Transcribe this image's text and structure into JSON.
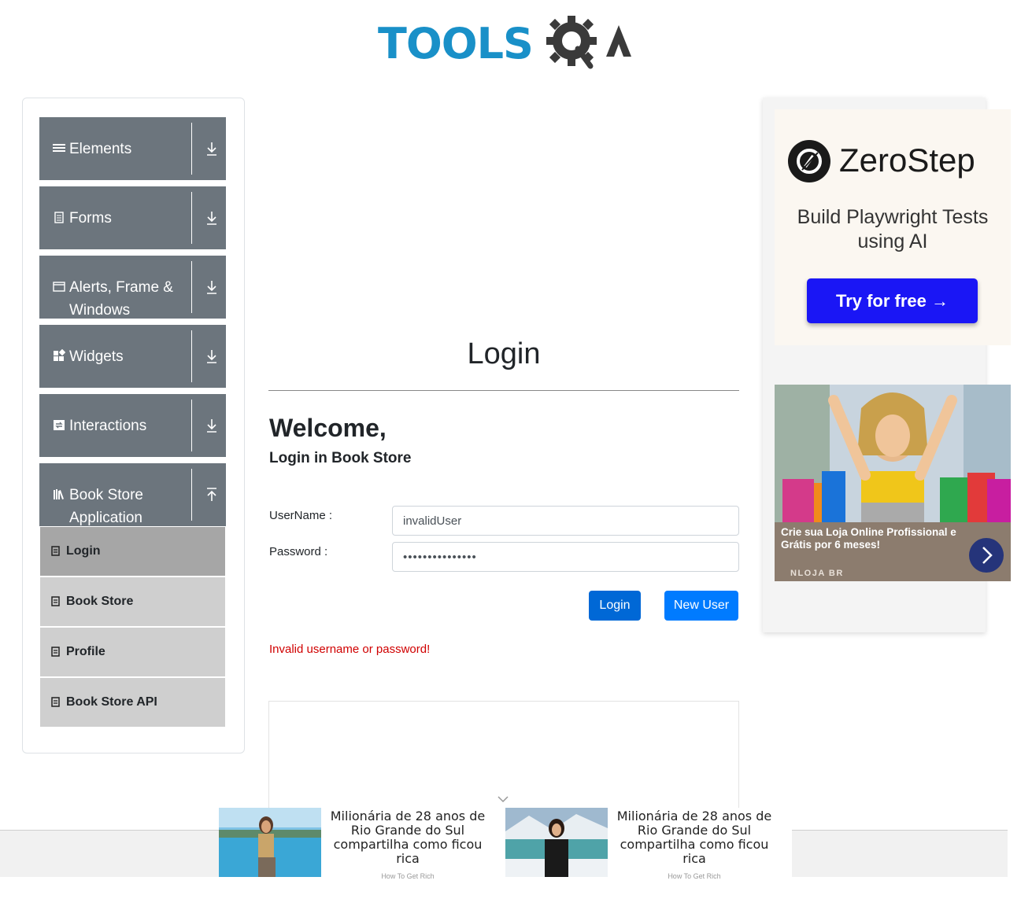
{
  "header": {
    "logo_text": "TOOLS",
    "logo_alt": "ToolsQA logo"
  },
  "sidebar": {
    "groups": [
      {
        "label": "Elements",
        "icon": "hamburger-icon",
        "expanded": false
      },
      {
        "label": "Forms",
        "icon": "document-icon",
        "expanded": false
      },
      {
        "label": "Alerts, Frame & Windows",
        "icon": "window-icon",
        "expanded": false
      },
      {
        "label": "Widgets",
        "icon": "widgets-icon",
        "expanded": false
      },
      {
        "label": "Interactions",
        "icon": "interactions-icon",
        "expanded": false
      },
      {
        "label": "Book Store Application",
        "icon": "library-icon",
        "expanded": true
      }
    ],
    "sub_items": [
      {
        "label": "Login",
        "active": true
      },
      {
        "label": "Book Store",
        "active": false
      },
      {
        "label": "Profile",
        "active": false
      },
      {
        "label": "Book Store API",
        "active": false
      }
    ]
  },
  "main": {
    "page_title": "Login",
    "welcome": "Welcome,",
    "subtitle": "Login in Book Store",
    "username_label": "UserName :",
    "username_value": "invalidUser",
    "password_label": "Password :",
    "password_value": "•••••••••••••••",
    "login_button": "Login",
    "new_user_button": "New User",
    "error_message": "Invalid username or password!"
  },
  "ads": {
    "zerostep": {
      "brand": "ZeroStep",
      "tagline": "Build Playwright Tests using AI",
      "cta": "Try for free →"
    },
    "nloja": {
      "text": "Crie sua Loja Online Profissional e Grátis por 6 meses!",
      "brand": "NLOJA BR"
    },
    "footer_ads": [
      {
        "text": "Milionária de 28 anos de Rio Grande do Sul compartilha como ficou rica",
        "source": "How To Get Rich"
      },
      {
        "text": "Milionária de 28 anos de Rio Grande do Sul compartilha como ficou rica",
        "source": "How To Get Rich"
      }
    ]
  },
  "colors": {
    "accent": "#007bff",
    "sidebar_group": "#6c757d",
    "error": "#d00000",
    "brand_blue": "#1990c8"
  }
}
